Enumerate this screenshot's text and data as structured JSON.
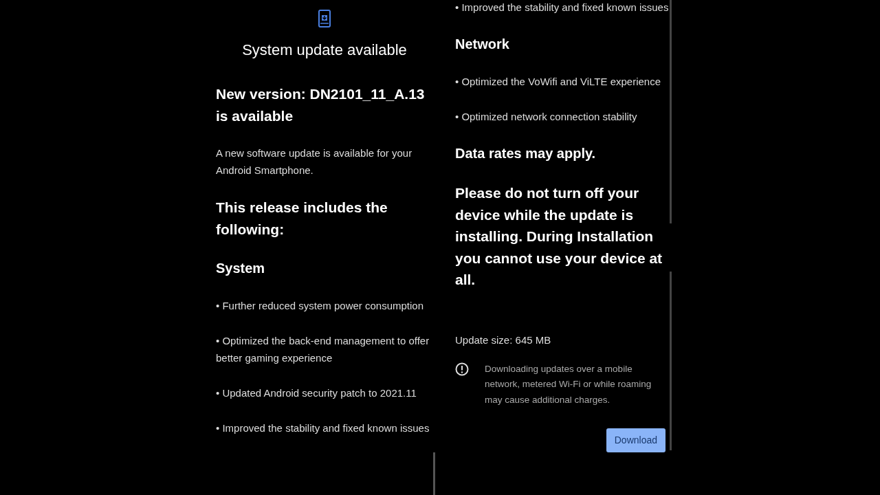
{
  "left_screen": {
    "title": "System update available",
    "blocks": [
      {
        "kind": "heading",
        "text": "New version: DN2101_11_A.13 is available"
      },
      {
        "kind": "paragraph",
        "text": "A new software update is available for your Android Smartphone."
      },
      {
        "kind": "heading",
        "text": "This release includes the following:"
      },
      {
        "kind": "section",
        "text": "System"
      },
      {
        "kind": "paragraph",
        "text": "• Further reduced system power consumption"
      },
      {
        "kind": "paragraph",
        "text": "• Optimized the back-end management to offer better gaming experience"
      },
      {
        "kind": "paragraph",
        "text": "• Updated Android security patch to 2021.11"
      },
      {
        "kind": "paragraph",
        "text": "• Improved the stability and fixed known issues"
      }
    ]
  },
  "right_screen": {
    "blocks": [
      {
        "kind": "paragraph",
        "text": "• Improved the stability and fixed known issues"
      },
      {
        "kind": "section",
        "text": "Network"
      },
      {
        "kind": "paragraph",
        "text": "• Optimized the VoWifi and ViLTE experience"
      },
      {
        "kind": "paragraph",
        "text": "• Optimized network connection stability"
      },
      {
        "kind": "section",
        "text": "Data rates may apply."
      },
      {
        "kind": "heading",
        "text": "Please do not turn off your device while the update is installing. During Installation you cannot use your device at all."
      }
    ],
    "update_size": "Update size: 645 MB",
    "notice": "Downloading updates over a mobile network, metered Wi-Fi or while roaming may cause additional charges.",
    "button": "Download"
  }
}
